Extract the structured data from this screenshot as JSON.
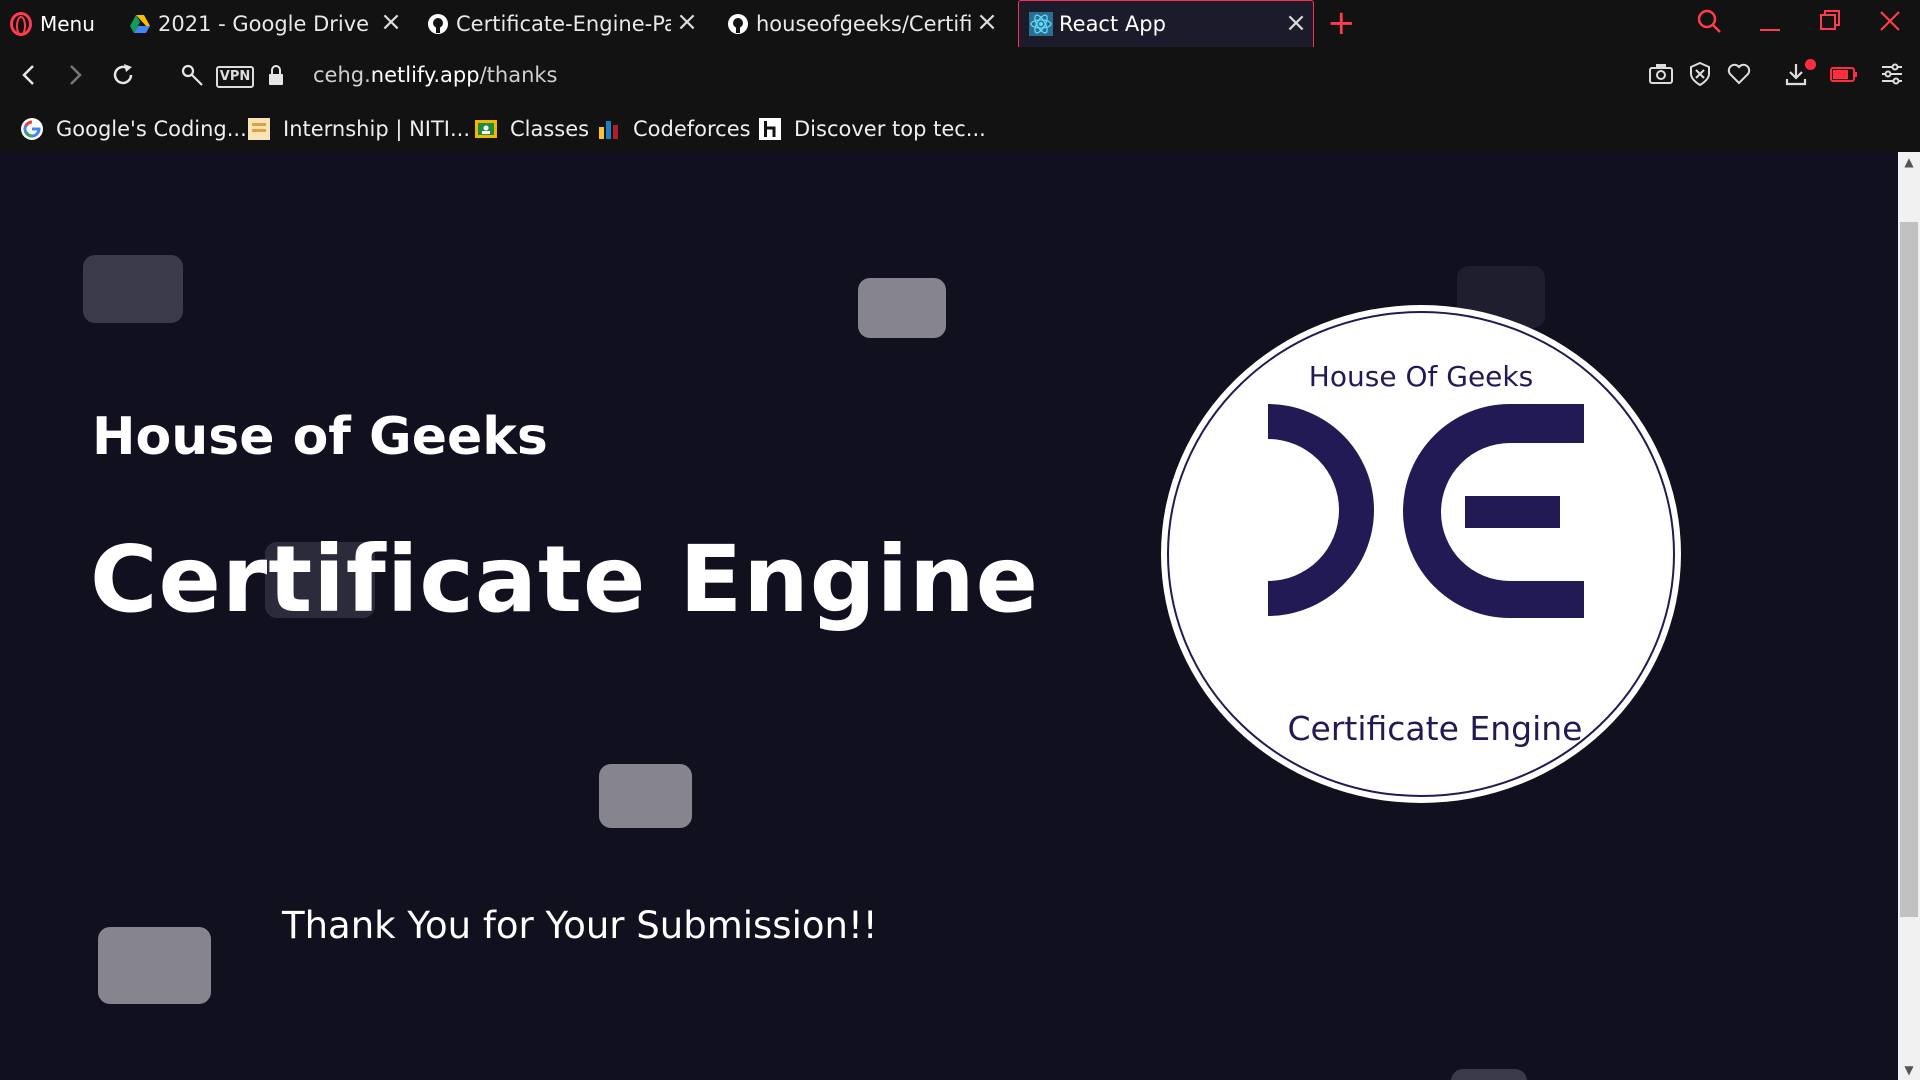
{
  "browser": {
    "menu_label": "Menu",
    "tabs": [
      {
        "title": "2021 - Google Drive",
        "icon": "google-drive-icon"
      },
      {
        "title": "Certificate-Engine-Parent",
        "icon": "github-icon"
      },
      {
        "title": "houseofgeeks/Certificate",
        "icon": "github-icon"
      },
      {
        "title": "React App",
        "icon": "react-icon",
        "active": true
      }
    ],
    "url_prefix": "cehg.",
    "url_host": "netlify.app",
    "url_path": "/thanks",
    "vpn_label": "VPN",
    "bookmarks": [
      {
        "label": "Google's Coding...",
        "icon": "google-icon"
      },
      {
        "label": "Internship | NITI...",
        "icon": "niti-icon"
      },
      {
        "label": "Classes",
        "icon": "google-classroom-icon"
      },
      {
        "label": "Codeforces",
        "icon": "codeforces-icon"
      },
      {
        "label": "Discover top tec...",
        "icon": "hashnode-icon"
      }
    ]
  },
  "page": {
    "org_title": "House of Geeks",
    "main_title": "Certificate Engine",
    "thanks_message": "Thank You for Your Submission!!",
    "logo": {
      "top_text": "House Of Geeks",
      "bottom_text": "Certificate Engine",
      "color": "#221a55"
    }
  },
  "colors": {
    "background": "#11101f",
    "accent": "#ff2d55"
  }
}
